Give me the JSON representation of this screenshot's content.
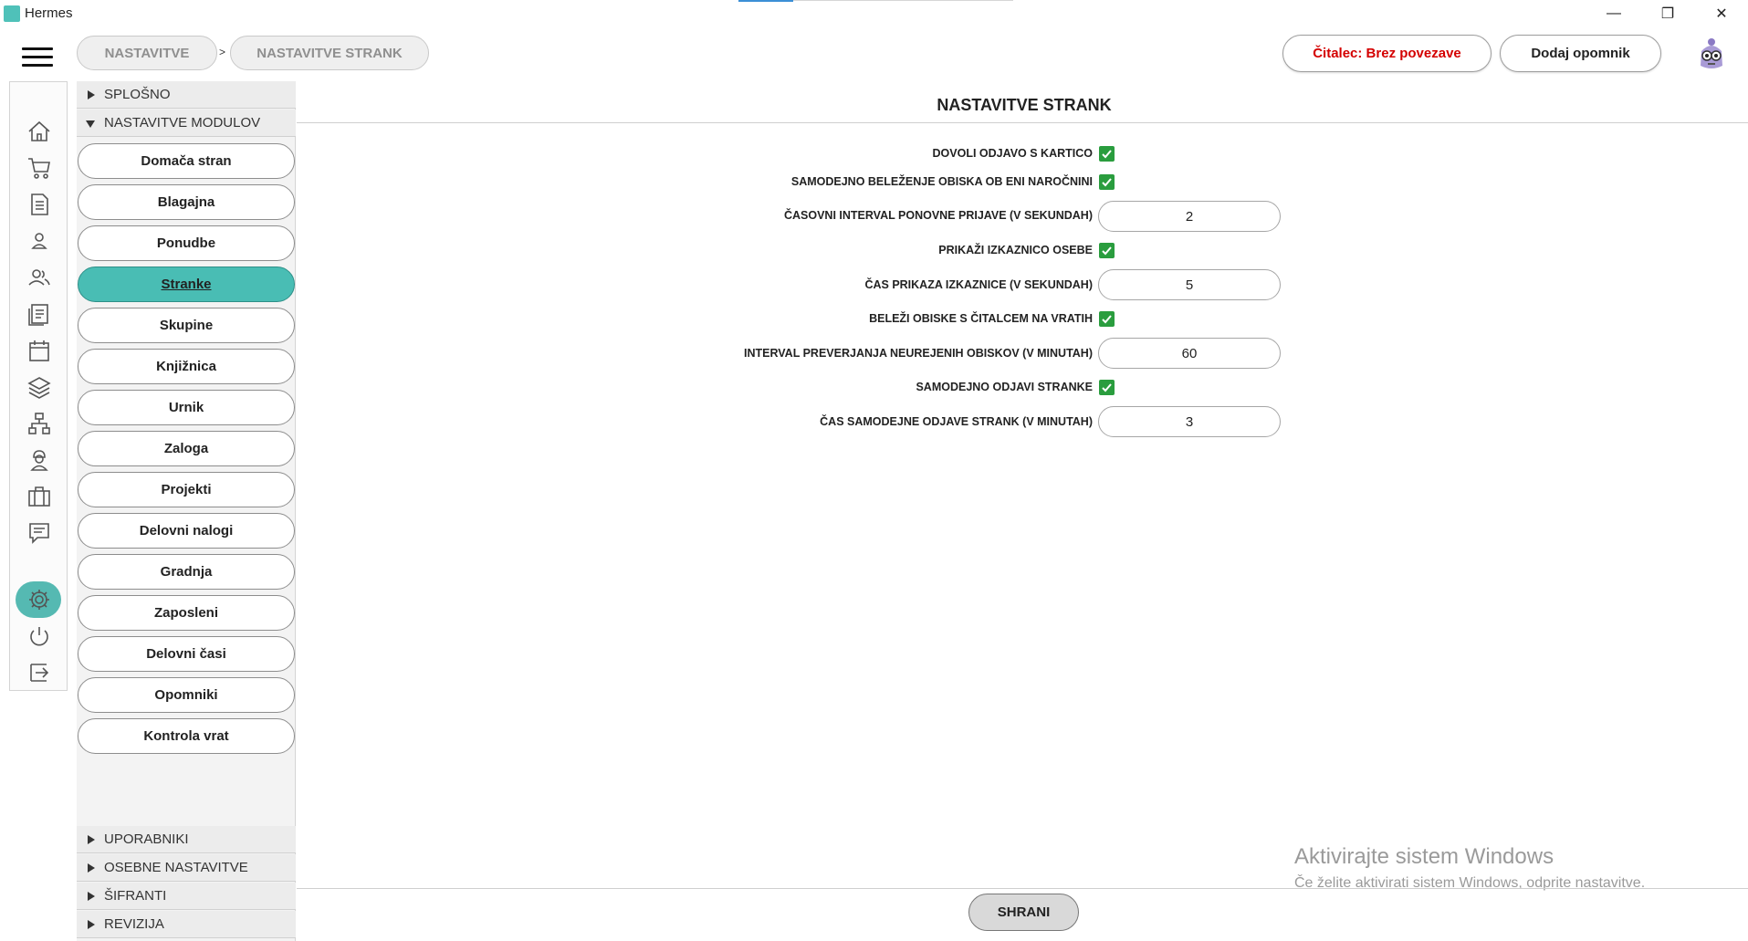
{
  "window": {
    "title": "Hermes",
    "minimize": "—",
    "maximize": "❐",
    "close": "✕"
  },
  "breadcrumb": [
    "NASTAVITVE",
    "NASTAVITVE STRANK"
  ],
  "breadcrumb_separator": ">",
  "header": {
    "reader_status": "Čitalec: Brez povezave",
    "add_reminder": "Dodaj opomnik"
  },
  "rail_icons": [
    "home-icon",
    "cart-icon",
    "document-icon",
    "person-icon",
    "people-icon",
    "articles-icon",
    "calendar-icon",
    "layers-icon",
    "network-icon",
    "worker-icon",
    "briefcase-icon",
    "chat-icon",
    "gear-icon",
    "power-icon",
    "logout-icon"
  ],
  "tree": {
    "sections_top": [
      {
        "label": "SPLOŠNO",
        "expanded": false
      },
      {
        "label": "NASTAVITVE MODULOV",
        "expanded": true
      }
    ],
    "modules": [
      "Domača stran",
      "Blagajna",
      "Ponudbe",
      "Stranke",
      "Skupine",
      "Knjižnica",
      "Urnik",
      "Zaloga",
      "Projekti",
      "Delovni nalogi",
      "Gradnja",
      "Zaposleni",
      "Delovni časi",
      "Opomniki",
      "Kontrola vrat"
    ],
    "active_module": "Stranke",
    "sections_bottom": [
      {
        "label": "UPORABNIKI"
      },
      {
        "label": "OSEBNE NASTAVITVE"
      },
      {
        "label": "ŠIFRANTI"
      },
      {
        "label": "REVIZIJA"
      }
    ]
  },
  "main": {
    "title": "NASTAVITVE STRANK",
    "fields": [
      {
        "label": "DOVOLI ODJAVO S KARTICO",
        "type": "checkbox",
        "checked": true
      },
      {
        "label": "SAMODEJNO BELEŽENJE OBISKA OB ENI NAROČNINI",
        "type": "checkbox",
        "checked": true
      },
      {
        "label": "ČASOVNI INTERVAL PONOVNE PRIJAVE (V SEKUNDAH)",
        "type": "number",
        "value": "2"
      },
      {
        "label": "PRIKAŽI IZKAZNICO OSEBE",
        "type": "checkbox",
        "checked": true
      },
      {
        "label": "ČAS PRIKAZA IZKAZNICE (V SEKUNDAH)",
        "type": "number",
        "value": "5"
      },
      {
        "label": "BELEŽI OBISKE S ČITALCEM NA VRATIH",
        "type": "checkbox",
        "checked": true
      },
      {
        "label": "INTERVAL PREVERJANJA NEUREJENIH OBISKOV (V MINUTAH)",
        "type": "number",
        "value": "60"
      },
      {
        "label": "SAMODEJNO ODJAVI STRANKE",
        "type": "checkbox",
        "checked": true
      },
      {
        "label": "ČAS SAMODEJNE ODJAVE STRANK (V MINUTAH)",
        "type": "number",
        "value": "3"
      }
    ],
    "save_label": "SHRANI"
  },
  "watermark": {
    "line1": "Aktivirajte sistem Windows",
    "line2": "Če želite aktivirati sistem Windows, odprite nastavitve."
  },
  "colors": {
    "accent": "#49bdb4",
    "checkbox": "#2a9d3e",
    "reader_status": "#d40000"
  }
}
